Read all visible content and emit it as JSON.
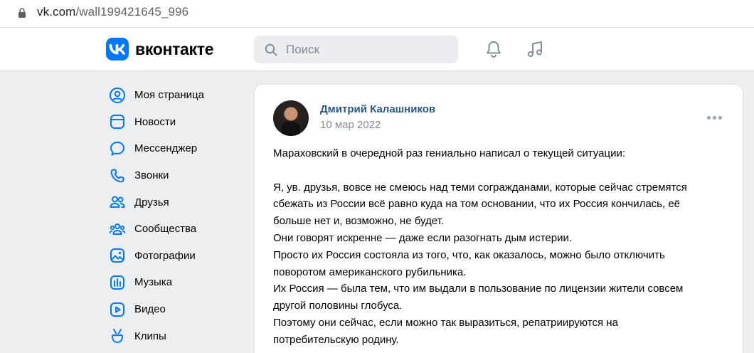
{
  "browser": {
    "url_host": "vk.com",
    "url_path": "/wall199421645_996"
  },
  "header": {
    "logo_text": "вконтакте",
    "search_placeholder": "Поиск"
  },
  "nav": {
    "items": [
      {
        "label": "Моя страница",
        "icon": "user-icon"
      },
      {
        "label": "Новости",
        "icon": "news-icon"
      },
      {
        "label": "Мессенджер",
        "icon": "message-icon"
      },
      {
        "label": "Звонки",
        "icon": "phone-icon"
      },
      {
        "label": "Друзья",
        "icon": "friends-icon"
      },
      {
        "label": "Сообщества",
        "icon": "communities-icon"
      },
      {
        "label": "Фотографии",
        "icon": "photos-icon"
      },
      {
        "label": "Музыка",
        "icon": "music-icon"
      },
      {
        "label": "Видео",
        "icon": "video-icon"
      },
      {
        "label": "Клипы",
        "icon": "clips-icon"
      }
    ]
  },
  "post": {
    "author": "Дмитрий Калашников",
    "date": "10 мар 2022",
    "intro": "Мараховский в очередной раз гениально написал о текущей ситуации:",
    "lines": [
      "Я, ув. друзья, вовсе не смеюсь над теми согражданами, которые сейчас стремятся",
      "сбежать из России всё равно куда на том основании, что их Россия кончилась, её",
      "больше нет и, возможно, не будет.",
      "Они говорят искренне — даже если разогнать дым истерии.",
      "Просто их Россия состояла из того, что, как оказалось, можно было отключить",
      "поворотом американского рубильника.",
      "Их Россия — была тем, что им выдали в пользование по лицензии жители совсем",
      "другой половины глобуса.",
      "Поэтому они сейчас, если можно так выразиться, репатриируются на",
      "потребительскую родину."
    ]
  },
  "colors": {
    "accent": "#0077ff",
    "link": "#2a5885",
    "secondary_text": "#818c99",
    "page_bg": "#edeef0"
  }
}
